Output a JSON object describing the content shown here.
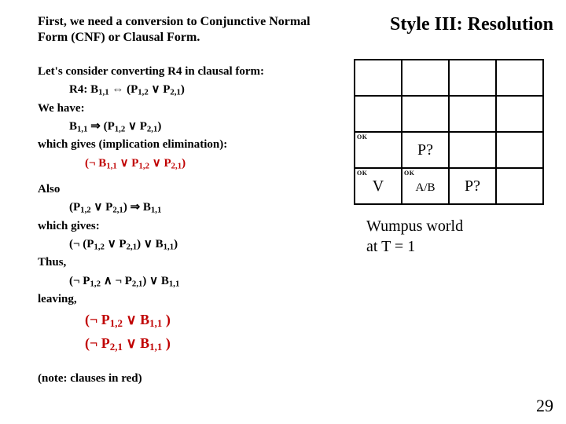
{
  "left": {
    "intro": "First, we need a conversion to Conjunctive Normal Form (CNF) or Clausal Form.",
    "l1": "Let's consider converting R4 in clausal form:",
    "l2_pre": "R4:  B",
    "l2_s1": "1,1",
    "l2_mid": " ⇔ (P",
    "l2_s2": "1,2",
    "l2_mid2": " ∨ P",
    "l2_s3": "2,1",
    "l2_end": ")",
    "l3": "We have:",
    "l4_pre": "B",
    "l4_s1": "1,1",
    "l4_mid": " ⇒ (P",
    "l4_s2": "1,2",
    "l4_or": " ∨ P",
    "l4_s3": "2,1",
    "l4_end": ")",
    "l5": "which gives (implication elimination):",
    "l6_pre": "(¬ B",
    "l6_s1": "1,1",
    "l6_or1": " ∨ P",
    "l6_s2": "1,2",
    "l6_or2": " ∨ P",
    "l6_s3": "2,1",
    "l6_end": ")",
    "l7": "Also",
    "l8_pre": "(P",
    "l8_s1": "1,2",
    "l8_or": " ∨ P",
    "l8_s2": "2,1",
    "l8_mid": ") ⇒ B",
    "l8_s3": "1,1",
    "l9": "which gives:",
    "l10_pre": "(¬ (P",
    "l10_s1": "1,2",
    "l10_or": " ∨ P",
    "l10_s2": "2,1",
    "l10_mid": ") ∨ B",
    "l10_s3": "1,1",
    "l10_end": ")",
    "l11": "Thus,",
    "l12_pre": "(¬ P",
    "l12_s1": "1,2",
    "l12_and": " ∧ ¬ P",
    "l12_s2": "2,1",
    "l12_mid": ") ∨ B",
    "l12_s3": "1,1",
    "l12_end": "",
    "l13": "leaving,",
    "l14_pre": "(¬ P",
    "l14_s1": "1,2",
    "l14_or": " ∨ B",
    "l14_s2": "1,1",
    "l14_end": " )",
    "l15_pre": "(¬ P",
    "l15_s1": "2,1",
    "l15_or": " ∨ B",
    "l15_s2": "1,1",
    "l15_end": " )",
    "note": "(note: clauses in red)"
  },
  "right": {
    "title": "Style III: Resolution",
    "ok": "OK",
    "p_q": "P?",
    "v": "V",
    "ab": "A/B",
    "caption1": "Wumpus world",
    "caption2": "at T = 1"
  },
  "page": "29"
}
